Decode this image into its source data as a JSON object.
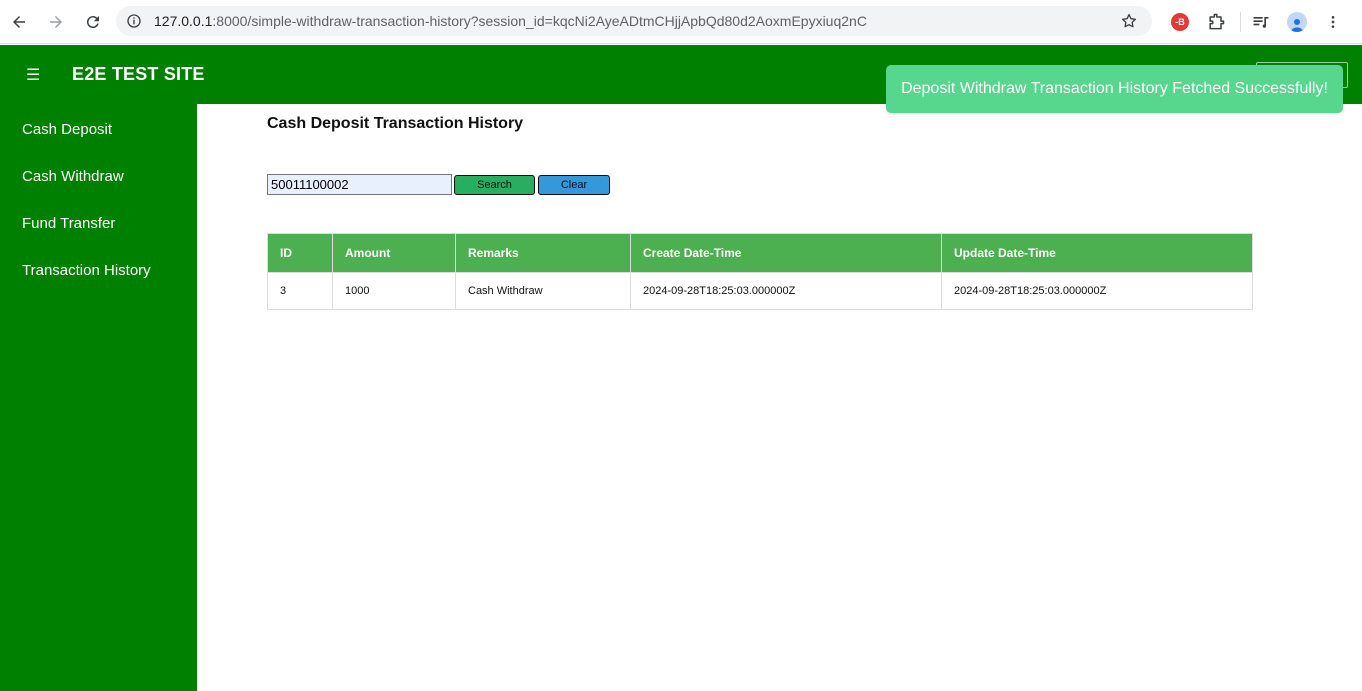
{
  "browser": {
    "url_host": "127.0.0.1",
    "url_rest": ":8000/simple-withdraw-transaction-history?session_id=kqcNi2AyeADtmCHjjApbQd80d2AoxmEpyxiuq2nC",
    "ext_badge": "-B"
  },
  "header": {
    "menu_icon": "☰",
    "title": "E2E TEST SITE"
  },
  "sidebar": {
    "items": [
      {
        "label": "Cash Deposit"
      },
      {
        "label": "Cash Withdraw"
      },
      {
        "label": "Fund Transfer"
      },
      {
        "label": "Transaction History"
      }
    ]
  },
  "main": {
    "title": "Cash Deposit Transaction History",
    "search": {
      "value": "50011100002"
    },
    "search_button": "Search",
    "clear_button": "Clear",
    "table": {
      "headers": [
        "ID",
        "Amount",
        "Remarks",
        "Create Date-Time",
        "Update Date-Time"
      ],
      "rows": [
        [
          "3",
          "1000",
          "Cash Withdraw",
          "2024-09-28T18:25:03.000000Z",
          "2024-09-28T18:25:03.000000Z"
        ]
      ]
    }
  },
  "toast": {
    "message": "Deposit Withdraw Transaction History Fetched Successfully!"
  },
  "colors": {
    "brand_green": "#008000",
    "table_header": "#4caf50",
    "search_button": "#27ae60",
    "clear_button": "#3498db",
    "toast": "#57d68d"
  }
}
